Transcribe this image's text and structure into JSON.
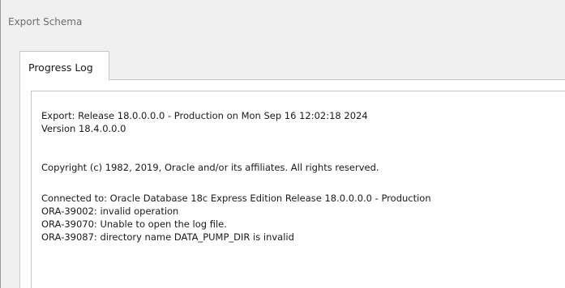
{
  "window": {
    "title": "Export Schema"
  },
  "tabs": [
    {
      "label": "Progress Log",
      "selected": true
    }
  ],
  "log": {
    "lines": [
      "Export: Release 18.0.0.0.0 - Production on Mon Sep 16 12:02:18 2024",
      "Version 18.4.0.0.0",
      "",
      "Copyright (c) 1982, 2019, Oracle and/or its affiliates.  All rights reserved.",
      "",
      "Connected to: Oracle Database 18c Express Edition Release 18.0.0.0.0 - Production",
      "ORA-39002: invalid operation",
      "ORA-39070: Unable to open the log file.",
      "ORA-39087: directory name DATA_PUMP_DIR is invalid"
    ]
  }
}
